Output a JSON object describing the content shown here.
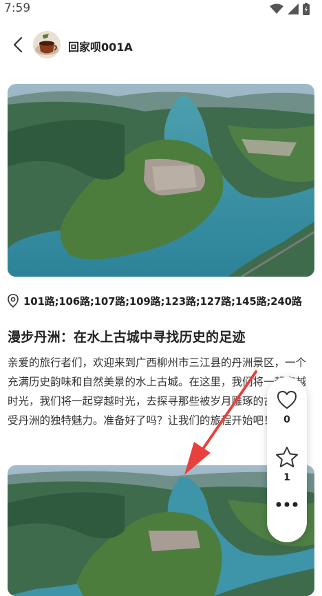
{
  "status_bar": {
    "time": "7:59",
    "icons": [
      "wifi-icon",
      "signal-icon",
      "battery-icon"
    ]
  },
  "header": {
    "back_icon": "back-arrow-icon",
    "author_name": "回家呗001A"
  },
  "location": {
    "icon": "location-pin-icon",
    "text": "101路;106路;107路;109路;123路;127路;145路;240路"
  },
  "post": {
    "title": "漫步丹洲：在水上古城中寻找历史的足迹",
    "body": "亲爱的旅行者们，欢迎来到广西柳州市三江县的丹洲景区，一个充满历史韵味和自然美景的水上古城。在这里，我们将一起穿越时光，我们将一起穿越时光，去探寻那些被岁月雕琢的古迹，感受丹洲的独特魅力。准备好了吗？让我们的旅程开始吧！"
  },
  "actions": {
    "like": {
      "icon": "heart-icon",
      "count": "0"
    },
    "favorite": {
      "icon": "star-icon",
      "count": "1"
    },
    "more": {
      "icon": "more-dots-icon"
    }
  },
  "colors": {
    "annotation_arrow": "#e8413d",
    "text": "#222222"
  }
}
